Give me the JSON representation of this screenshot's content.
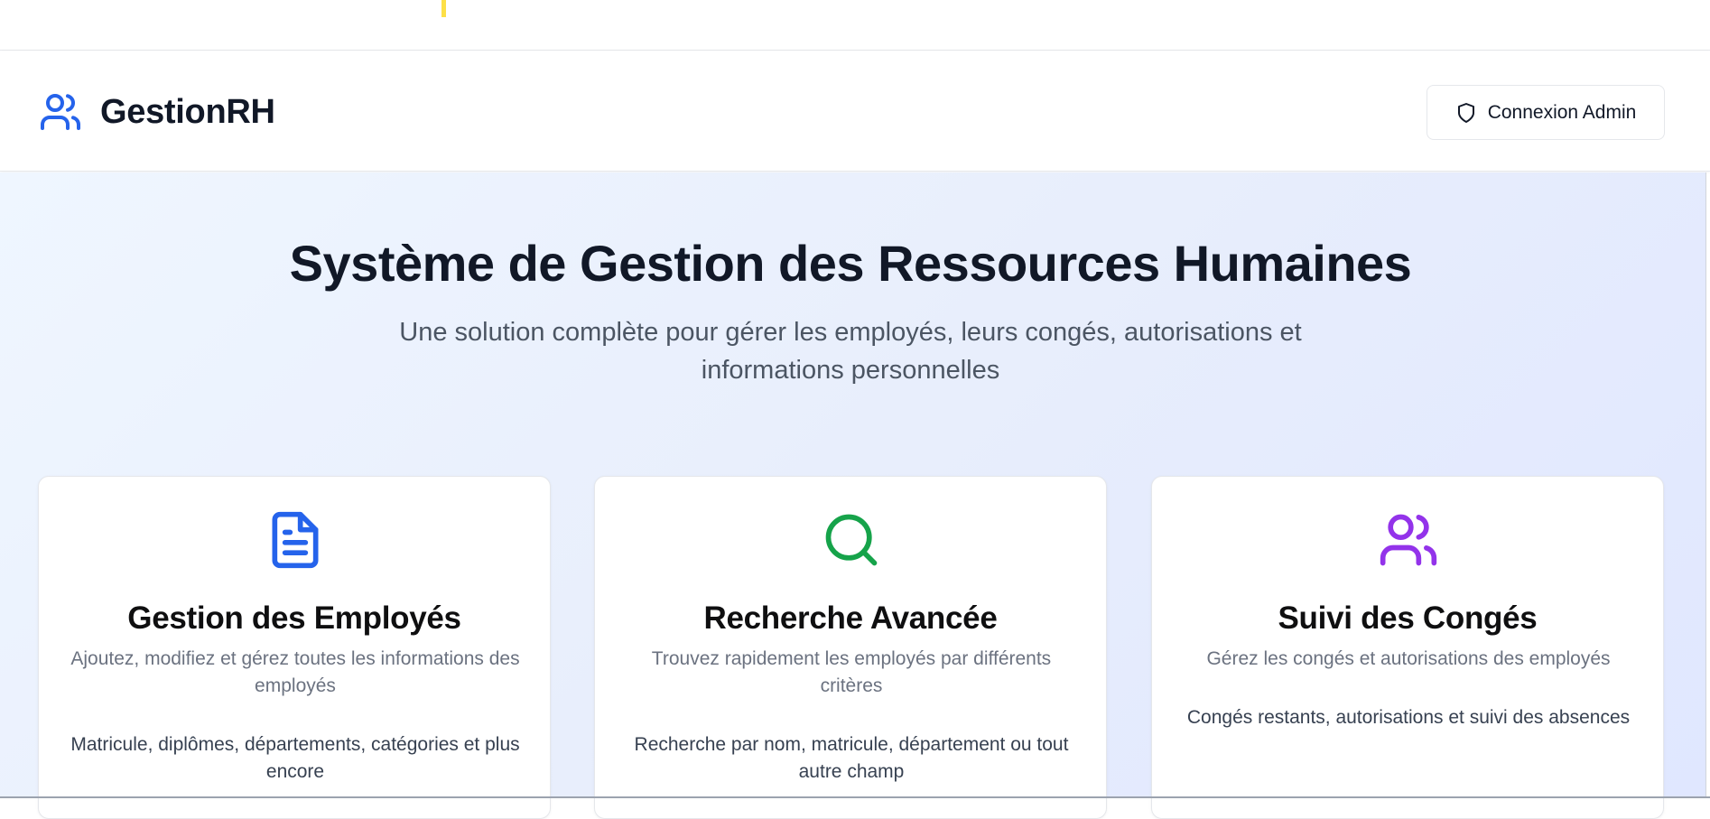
{
  "navbar": {
    "brand_name": "GestionRH",
    "admin_button_label": "Connexion Admin"
  },
  "hero": {
    "title": "Système de Gestion des Ressources Humaines",
    "subtitle": "Une solution complète pour gérer les employés, leurs congés, autorisations et informations personnelles"
  },
  "features": [
    {
      "title": "Gestion des Employés",
      "description": "Ajoutez, modifiez et gérez toutes les informations des employés",
      "detail": "Matricule, diplômes, départements, catégories et plus encore",
      "icon": "file-text-icon",
      "color": "#2563eb"
    },
    {
      "title": "Recherche Avancée",
      "description": "Trouvez rapidement les employés par différents critères",
      "detail": "Recherche par nom, matricule, département ou tout autre champ",
      "icon": "search-icon",
      "color": "#16a34a"
    },
    {
      "title": "Suivi des Congés",
      "description": "Gérez les congés et autorisations des employés",
      "detail": "Congés restants, autorisations et suivi des absences",
      "icon": "users-icon",
      "color": "#9333ea"
    }
  ],
  "colors": {
    "brand_blue": "#2563eb",
    "text_dark": "#111827",
    "text_muted": "#4b5563",
    "hero_bg_start": "#eff6ff",
    "hero_bg_end": "#e0e7ff"
  }
}
